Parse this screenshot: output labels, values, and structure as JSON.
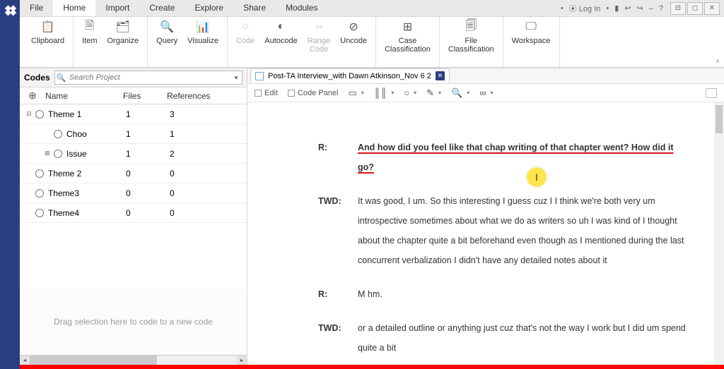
{
  "menu": {
    "tabs": [
      "File",
      "Home",
      "Import",
      "Create",
      "Explore",
      "Share",
      "Modules"
    ],
    "active_index": 1,
    "login": "Log In"
  },
  "ribbon": {
    "groups": [
      {
        "items": [
          {
            "icon": "📋",
            "label": "Clipboard"
          }
        ]
      },
      {
        "items": [
          {
            "icon": "🗎",
            "label": "Item"
          },
          {
            "icon": "🗂",
            "label": "Organize"
          }
        ]
      },
      {
        "items": [
          {
            "icon": "🔍",
            "label": "Query"
          },
          {
            "icon": "📊",
            "label": "Visualize"
          }
        ]
      },
      {
        "items": [
          {
            "icon": "○",
            "label": "Code",
            "disabled": true
          },
          {
            "icon": "◐",
            "label": "Autocode"
          },
          {
            "icon": "⇔",
            "label": "Range\nCode",
            "disabled": true
          },
          {
            "icon": "⊘",
            "label": "Uncode"
          }
        ]
      },
      {
        "items": [
          {
            "icon": "⊞",
            "label": "Case\nClassification"
          }
        ]
      },
      {
        "items": [
          {
            "icon": "🗐",
            "label": "File\nClassification"
          }
        ]
      },
      {
        "items": [
          {
            "icon": "🖵",
            "label": "Workspace"
          }
        ]
      }
    ]
  },
  "side": {
    "title": "Codes",
    "search_placeholder": "Search Project",
    "columns": {
      "name": "Name",
      "files": "Files",
      "refs": "References"
    },
    "nodes": [
      {
        "indent": 0,
        "twist": "⊟",
        "name": "Theme 1",
        "files": "1",
        "refs": "3"
      },
      {
        "indent": 1,
        "twist": "",
        "name": "Choo",
        "files": "1",
        "refs": "1"
      },
      {
        "indent": 1,
        "twist": "⊞",
        "name": "Issue",
        "files": "1",
        "refs": "2"
      },
      {
        "indent": 0,
        "twist": "",
        "name": "Theme 2",
        "files": "0",
        "refs": "0"
      },
      {
        "indent": 0,
        "twist": "",
        "name": "Theme3",
        "files": "0",
        "refs": "0"
      },
      {
        "indent": 0,
        "twist": "",
        "name": "Theme4",
        "files": "0",
        "refs": "0"
      }
    ],
    "hint": "Drag selection here to code to a new code"
  },
  "doc": {
    "tab_title": "Post-TA Interview_with Dawn Atkinson_Nov 6 2",
    "toolbar": {
      "edit": "Edit",
      "codepanel": "Code Panel"
    },
    "rows": [
      {
        "speaker": "R:",
        "text": "And how did you feel like that chap writing of that chapter went?  How did it go?",
        "highlight": true
      },
      {
        "speaker": "TWD:",
        "text": "It was good, I um.  So this interesting I guess cuz I I think we're both very um introspective sometimes about what we do as writers so uh I was kind of I thought about the chapter quite a bit beforehand even though as I mentioned during the last concurrent verbalization I didn't have any detailed notes about it"
      },
      {
        "speaker": "R:",
        "text": "M hm."
      },
      {
        "speaker": "TWD:",
        "text": "or a detailed outline or anything just cuz that's not the way I work but I did um spend quite a bit"
      }
    ]
  },
  "cursor": {
    "glyph": "I"
  }
}
